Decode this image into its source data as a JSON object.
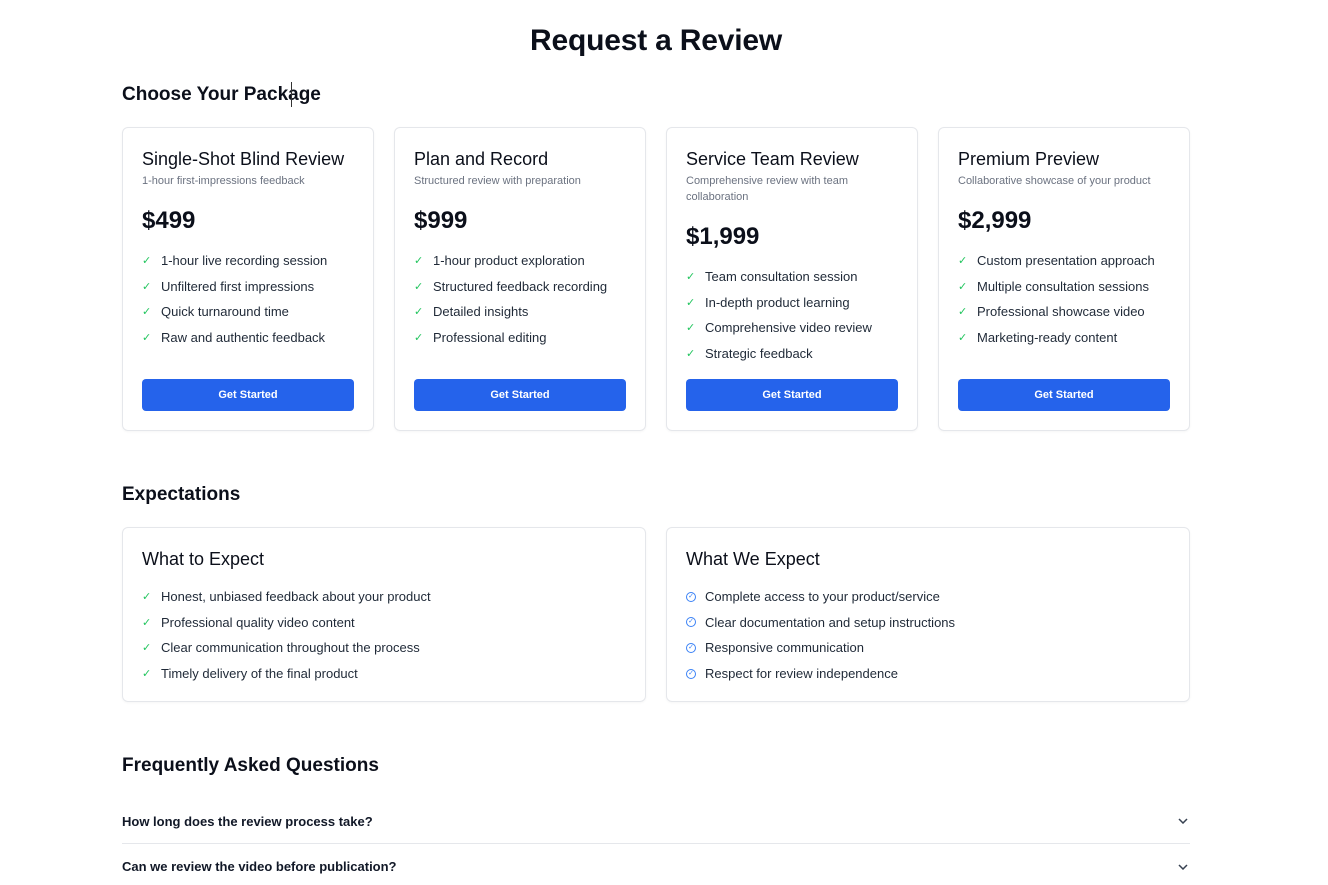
{
  "page_title": "Request a Review",
  "packages_title": "Choose Your Package",
  "expectations_title": "Expectations",
  "faq_title": "Frequently Asked Questions",
  "packages": [
    {
      "name": "Single-Shot Blind Review",
      "subtitle": "1-hour first-impressions feedback",
      "price": "$499",
      "features": [
        "1-hour live recording session",
        "Unfiltered first impressions",
        "Quick turnaround time",
        "Raw and authentic feedback"
      ],
      "cta": "Get Started"
    },
    {
      "name": "Plan and Record",
      "subtitle": "Structured review with preparation",
      "price": "$999",
      "features": [
        "1-hour product exploration",
        "Structured feedback recording",
        "Detailed insights",
        "Professional editing"
      ],
      "cta": "Get Started"
    },
    {
      "name": "Service Team Review",
      "subtitle": "Comprehensive review with team collaboration",
      "price": "$1,999",
      "features": [
        "Team consultation session",
        "In-depth product learning",
        "Comprehensive video review",
        "Strategic feedback"
      ],
      "cta": "Get Started"
    },
    {
      "name": "Premium Preview",
      "subtitle": "Collaborative showcase of your product",
      "price": "$2,999",
      "features": [
        "Custom presentation approach",
        "Multiple consultation sessions",
        "Professional showcase video",
        "Marketing-ready content"
      ],
      "cta": "Get Started"
    }
  ],
  "what_to_expect": {
    "title": "What to Expect",
    "items": [
      "Honest, unbiased feedback about your product",
      "Professional quality video content",
      "Clear communication throughout the process",
      "Timely delivery of the final product"
    ]
  },
  "what_we_expect": {
    "title": "What We Expect",
    "items": [
      "Complete access to your product/service",
      "Clear documentation and setup instructions",
      "Responsive communication",
      "Respect for review independence"
    ]
  },
  "faq": [
    {
      "question": "How long does the review process take?"
    },
    {
      "question": "Can we review the video before publication?"
    }
  ],
  "colors": {
    "accent": "#2563eb",
    "check": "#22c55e",
    "circle_check": "#3b82f6"
  },
  "icons": {
    "feature": "check-icon",
    "requirement": "circle-check-icon",
    "faq_toggle": "chevron-down-icon"
  }
}
